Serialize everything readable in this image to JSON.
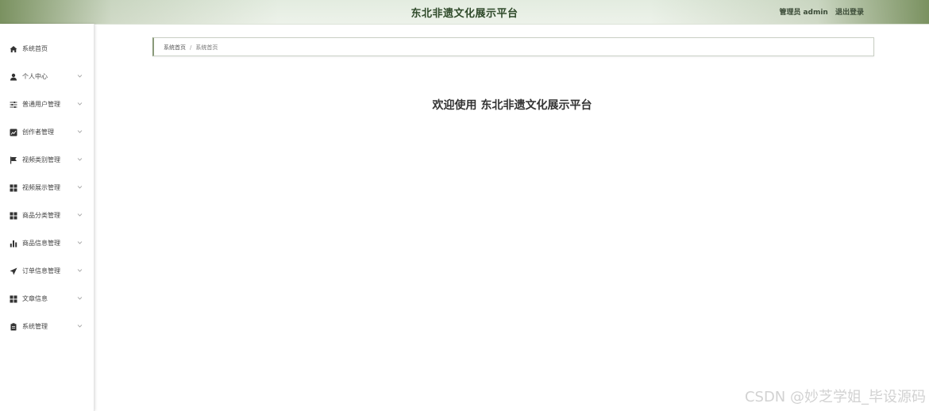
{
  "header": {
    "title": "东北非遗文化展示平台",
    "user_role": "管理员",
    "user_name": "admin",
    "logout_label": "退出登录"
  },
  "sidebar": {
    "items": [
      {
        "label": "系统首页",
        "icon": "home-icon",
        "has_arrow": false
      },
      {
        "label": "个人中心",
        "icon": "user-icon",
        "has_arrow": true
      },
      {
        "label": "普通用户管理",
        "icon": "sliders-icon",
        "has_arrow": true
      },
      {
        "label": "创作者管理",
        "icon": "chart-square-icon",
        "has_arrow": true
      },
      {
        "label": "视频类别管理",
        "icon": "flag-icon",
        "has_arrow": true
      },
      {
        "label": "视频展示管理",
        "icon": "grid-icon",
        "has_arrow": true
      },
      {
        "label": "商品分类管理",
        "icon": "grid-icon",
        "has_arrow": true
      },
      {
        "label": "商品信息管理",
        "icon": "bar-chart-icon",
        "has_arrow": true
      },
      {
        "label": "订单信息管理",
        "icon": "send-icon",
        "has_arrow": true
      },
      {
        "label": "文章信息",
        "icon": "grid-icon",
        "has_arrow": true
      },
      {
        "label": "系统管理",
        "icon": "clipboard-icon",
        "has_arrow": true
      }
    ]
  },
  "breadcrumb": {
    "home": "系统首页",
    "separator": "/",
    "current": "系统首页"
  },
  "main": {
    "welcome_prefix": "欢迎使用",
    "welcome_title": "东北非遗文化展示平台"
  },
  "watermark": "CSDN @妙芝学姐_毕设源码"
}
